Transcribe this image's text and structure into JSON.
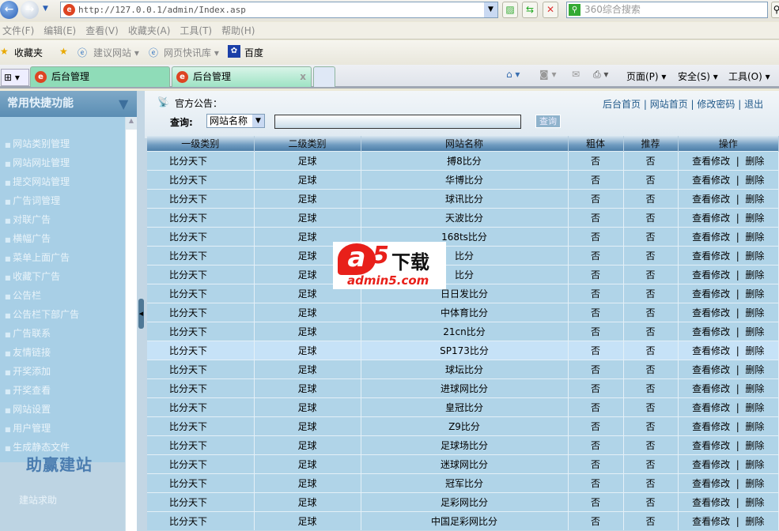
{
  "browser": {
    "url": "http://127.0.0.1/admin/Index.asp",
    "search_placeholder": "360综合搜索",
    "menu": [
      "文件(F)",
      "编辑(E)",
      "查看(V)",
      "收藏夹(A)",
      "工具(T)",
      "帮助(H)"
    ],
    "favorites": {
      "label": "收藏夹",
      "items": [
        "建议网站 ▾",
        "网页快讯库 ▾",
        "百度"
      ]
    },
    "tabs": [
      "后台管理",
      "后台管理"
    ],
    "cmd": [
      "页面(P) ▾",
      "安全(S) ▾",
      "工具(O) ▾"
    ]
  },
  "sidebar": {
    "title": "常用快捷功能",
    "items": [
      "网站类别管理",
      "网站网址管理",
      "提交网站管理",
      "广告词管理",
      "对联广告",
      "横幅广告",
      "菜单上面广告",
      "收藏下广告",
      "公告栏",
      "公告栏下部广告",
      "广告联系",
      "友情链接",
      "开奖添加",
      "开奖查看",
      "网站设置",
      "用户管理",
      "生成静态文件"
    ],
    "brand": "助赢建站",
    "help": "建站求助"
  },
  "header": {
    "notice": "官方公告：",
    "links": [
      "后台首页",
      "网站首页",
      "修改密码",
      "退出"
    ],
    "query_label": "查询:",
    "query_field": "网站名称",
    "query_button": "查询"
  },
  "table": {
    "columns": [
      "一级类别",
      "二级类别",
      "网站名称",
      "粗体",
      "推荐",
      "操作"
    ],
    "rows": [
      [
        "比分天下",
        "足球",
        "搏8比分",
        "否",
        "否"
      ],
      [
        "比分天下",
        "足球",
        "华博比分",
        "否",
        "否"
      ],
      [
        "比分天下",
        "足球",
        "球讯比分",
        "否",
        "否"
      ],
      [
        "比分天下",
        "足球",
        "天波比分",
        "否",
        "否"
      ],
      [
        "比分天下",
        "足球",
        "168ts比分",
        "否",
        "否"
      ],
      [
        "比分天下",
        "足球",
        "比分",
        "否",
        "否"
      ],
      [
        "比分天下",
        "足球",
        "比分",
        "否",
        "否"
      ],
      [
        "比分天下",
        "足球",
        "日日发比分",
        "否",
        "否"
      ],
      [
        "比分天下",
        "足球",
        "中体育比分",
        "否",
        "否"
      ],
      [
        "比分天下",
        "足球",
        "21cn比分",
        "否",
        "否"
      ],
      [
        "比分天下",
        "足球",
        "SP173比分",
        "否",
        "否"
      ],
      [
        "比分天下",
        "足球",
        "球坛比分",
        "否",
        "否"
      ],
      [
        "比分天下",
        "足球",
        "进球网比分",
        "否",
        "否"
      ],
      [
        "比分天下",
        "足球",
        "皇冠比分",
        "否",
        "否"
      ],
      [
        "比分天下",
        "足球",
        "Z9比分",
        "否",
        "否"
      ],
      [
        "比分天下",
        "足球",
        "足球场比分",
        "否",
        "否"
      ],
      [
        "比分天下",
        "足球",
        "迷球网比分",
        "否",
        "否"
      ],
      [
        "比分天下",
        "足球",
        "冠军比分",
        "否",
        "否"
      ],
      [
        "比分天下",
        "足球",
        "足彩网比分",
        "否",
        "否"
      ],
      [
        "比分天下",
        "足球",
        "中国足彩网比分",
        "否",
        "否"
      ]
    ],
    "edit_label": "查看修改",
    "delete_label": "删除"
  },
  "watermark": {
    "text": "a5下载",
    "domain": "admin5.com"
  }
}
